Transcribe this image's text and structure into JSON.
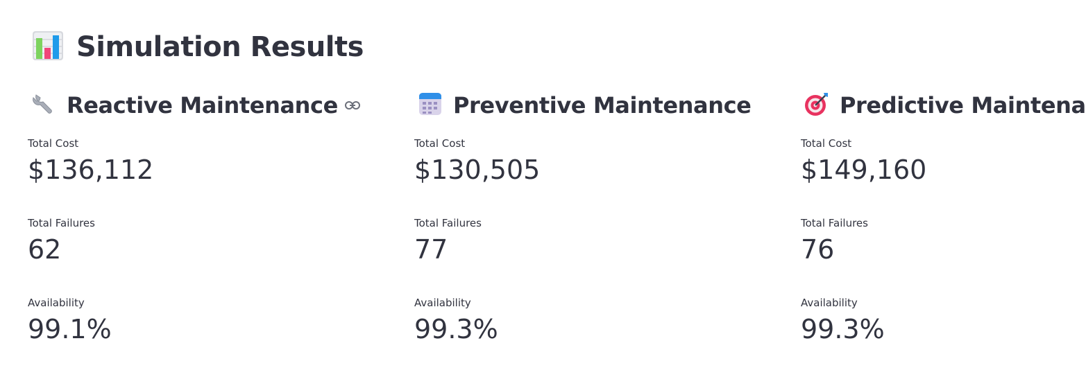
{
  "page": {
    "title": "Simulation Results",
    "title_icon": "bar-chart-icon"
  },
  "columns": [
    {
      "heading": "Reactive Maintenance",
      "icon": "wrench-icon",
      "has_anchor_link": true,
      "metrics": {
        "cost_label": "Total Cost",
        "cost_value": "$136,112",
        "failures_label": "Total Failures",
        "failures_value": "62",
        "availability_label": "Availability",
        "availability_value": "99.1%"
      }
    },
    {
      "heading": "Preventive Maintenance",
      "icon": "calendar-icon",
      "metrics": {
        "cost_label": "Total Cost",
        "cost_value": "$130,505",
        "failures_label": "Total Failures",
        "failures_value": "77",
        "availability_label": "Availability",
        "availability_value": "99.3%"
      }
    },
    {
      "heading": "Predictive Maintenance",
      "icon": "target-icon",
      "metrics": {
        "cost_label": "Total Cost",
        "cost_value": "$149,160",
        "failures_label": "Total Failures",
        "failures_value": "76",
        "availability_label": "Availability",
        "availability_value": "99.3%"
      }
    }
  ],
  "colors": {
    "text": "#31333f",
    "background": "#ffffff"
  }
}
